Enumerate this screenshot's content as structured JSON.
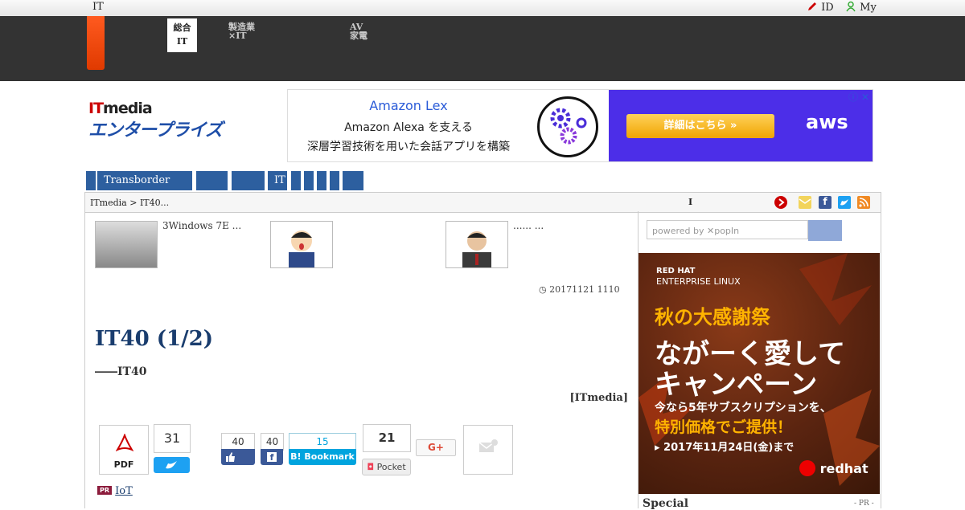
{
  "topbar": {
    "left_label": "IT",
    "id_label": "ID",
    "my_label": "My"
  },
  "nav": {
    "tab1_line1": "総合",
    "tab1_line2": "IT",
    "tab2_line1": "製造業",
    "tab2_line2": "×IT",
    "tab3_line1": "AV",
    "tab3_line2": "家電"
  },
  "logo": {
    "line1_red": "IT",
    "line1_rest": "media",
    "line2": "エンタープライズ"
  },
  "ad": {
    "title": "Amazon Lex",
    "line1": "Amazon Alexa を支える",
    "line2": "深層学習技術を用いた会話アプリを構築",
    "button": "詳細はこちら »",
    "brand": "aws"
  },
  "categories": [
    "Transborder",
    "",
    "",
    "IT",
    "",
    "",
    "",
    "",
    ""
  ],
  "breadcrumb": {
    "path": "ITmedia  > IT40...",
    "marker": "I"
  },
  "related": [
    {
      "text": "3Windows 7E ..."
    },
    {
      "text": ""
    },
    {
      "text": "...... ..."
    }
  ],
  "article": {
    "date": "20171121 1110",
    "title": "IT40 (1/2)",
    "subtitle": "――IT40",
    "credit": "[ITmedia]"
  },
  "share": {
    "pdf_label": "PDF",
    "twitter_count": "31",
    "fb_like_count": "40",
    "fb_share_count": "40",
    "hatena_count": "15",
    "hatena_label": "B! Bookmark",
    "pocket_count": "21",
    "pocket_label": "Pocket",
    "gplus_label": "G+"
  },
  "pr": {
    "badge": "PR",
    "text": "IoT"
  },
  "sidebar": {
    "search_placeholder": "powered by ✕popIn",
    "rh_brand1": "RED HAT",
    "rh_brand2": "ENTERPRISE LINUX",
    "rh_copy1": "秋の大感謝祭",
    "rh_copy2": "ながーく愛して",
    "rh_copy3": "キャンペーン",
    "rh_copy4": "今なら5年サブスクリプションを、",
    "rh_copy5": "特別価格でご提供！",
    "rh_copy6": "▸ 2017年11月24日(金)まで",
    "rh_logo": "redhat",
    "special_label": "Special",
    "special_pr": "- PR -"
  },
  "colors": {
    "nav_dark": "#333333",
    "accent_orange": "#ff5a1f",
    "category_blue": "#2d5f9f",
    "headline": "#1a3d6e"
  }
}
